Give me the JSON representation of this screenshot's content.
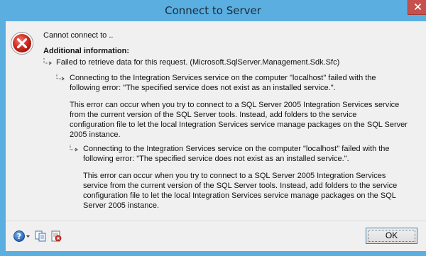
{
  "window": {
    "title": "Connect to Server",
    "accent": "#5aaee0"
  },
  "message": {
    "headline": "Cannot connect to ..",
    "additional_info_label": "Additional information:",
    "level1": "Failed to retrieve data for this request. (Microsoft.SqlServer.Management.Sdk.Sfc)",
    "level2_line1": "Connecting to the Integration Services service on the computer \"localhost\" failed with the",
    "level2_line2": "following error: \"The specified service does not exist as an installed service.\".",
    "level2_detail_line1": "This error can occur when you try to connect to a SQL Server 2005 Integration Services service",
    "level2_detail_line2": "from the current version of the SQL Server tools. Instead, add folders to the service",
    "level2_detail_line3": "configuration file to let the local Integration Services service manage packages on the SQL Server",
    "level2_detail_line4": "2005 instance.",
    "level3_line1": "Connecting to the Integration Services service on the computer \"localhost\" failed with the",
    "level3_line2": "following error: \"The specified service does not exist as an installed service.\".",
    "level3_detail_line1": "This error can occur when you try to connect to a SQL Server 2005 Integration Services",
    "level3_detail_line2": "service from the current version of the SQL Server tools. Instead, add folders to the service",
    "level3_detail_line3": "configuration file to let the local Integration Services service manage packages on the SQL",
    "level3_detail_line4": "Server 2005 instance."
  },
  "footer": {
    "ok_label": "OK",
    "icons": [
      "help-icon",
      "copy-icon",
      "show-details-icon"
    ]
  }
}
